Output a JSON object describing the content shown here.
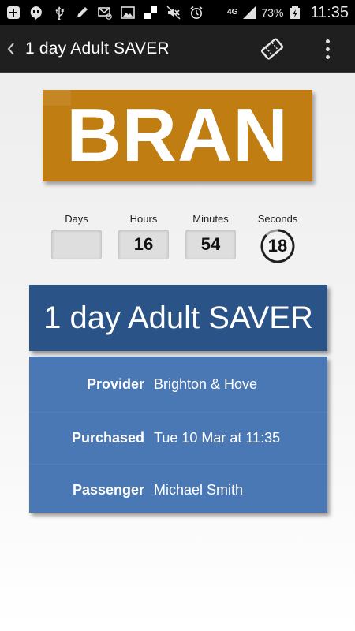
{
  "status_bar": {
    "icons": [
      "plus-icon",
      "hangouts-icon",
      "usb-icon",
      "pen-icon",
      "email-icon",
      "image-icon",
      "checkerboard-icon",
      "mute-icon",
      "alarm-icon"
    ],
    "network": "4G",
    "battery_percent": "73%",
    "time": "11:35"
  },
  "action_bar": {
    "title": "1 day Adult SAVER",
    "icons": [
      "back-icon",
      "ticket-icon",
      "overflow-menu-icon"
    ]
  },
  "logo": {
    "text": "BRAN",
    "color": "#c07d12"
  },
  "countdown": {
    "days_label": "Days",
    "days_value": "",
    "hours_label": "Hours",
    "hours_value": "16",
    "minutes_label": "Minutes",
    "minutes_value": "54",
    "seconds_label": "Seconds",
    "seconds_value": "18"
  },
  "ticket": {
    "name": "1 day Adult SAVER",
    "banner_color": "#2a5387",
    "details_color": "#4a78b4",
    "details": [
      {
        "label": "Provider",
        "value": "Brighton & Hove"
      },
      {
        "label": "Purchased",
        "value": "Tue 10 Mar at 11:35"
      },
      {
        "label": "Passenger",
        "value": "Michael Smith"
      }
    ]
  }
}
